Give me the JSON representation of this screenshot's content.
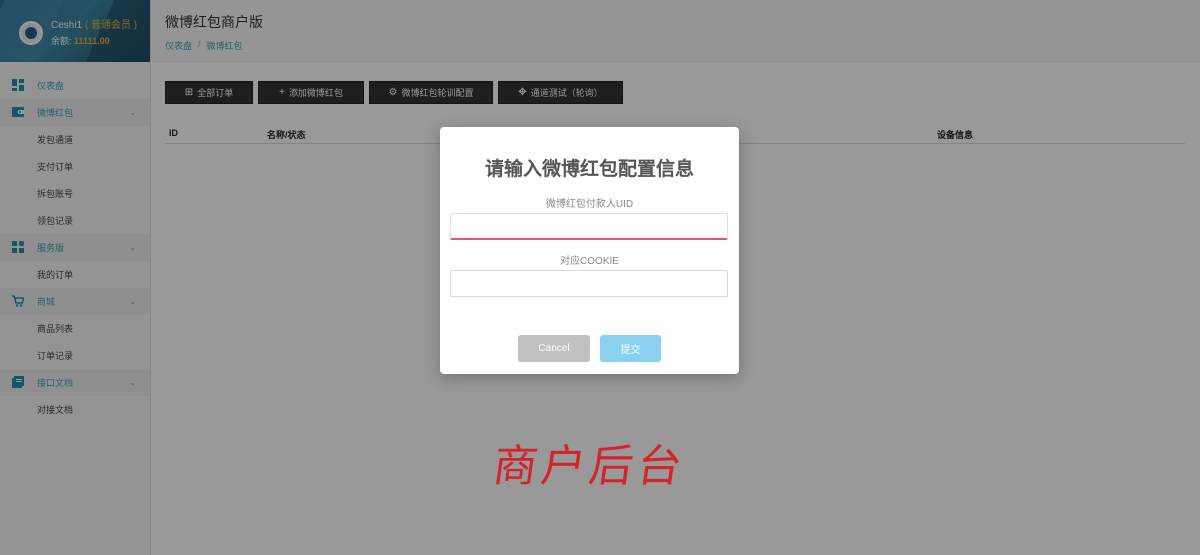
{
  "profile": {
    "name": "Ceshi1",
    "vip_badge": "( 普通会员 )",
    "balance_label": "余额:",
    "balance_value": "11111.00"
  },
  "sidebar": {
    "items": [
      {
        "label": "仪表盘",
        "icon": "dashboard-icon",
        "type": "parent",
        "expandable": false
      },
      {
        "label": "微博红包",
        "icon": "wallet-icon",
        "type": "parent",
        "expandable": true
      },
      {
        "label": "发包通道",
        "type": "child"
      },
      {
        "label": "支付订单",
        "type": "child"
      },
      {
        "label": "拆包账号",
        "type": "child"
      },
      {
        "label": "领包记录",
        "type": "child"
      },
      {
        "label": "服务版",
        "icon": "grid-icon",
        "type": "parent",
        "expandable": true
      },
      {
        "label": "我的订单",
        "type": "child"
      },
      {
        "label": "商城",
        "icon": "cart-icon",
        "type": "parent",
        "expandable": true
      },
      {
        "label": "商品列表",
        "type": "child"
      },
      {
        "label": "订单记录",
        "type": "child"
      },
      {
        "label": "接口文档",
        "icon": "docs-icon",
        "type": "parent",
        "expandable": true
      },
      {
        "label": "对接文档",
        "type": "child"
      }
    ]
  },
  "header": {
    "title": "微博红包商户版",
    "breadcrumb": [
      "仪表盘",
      "微博红包"
    ]
  },
  "toolbar": {
    "buttons": [
      {
        "label": "全部订单",
        "icon": "table-icon"
      },
      {
        "label": "添加微博红包",
        "icon": "plus-icon"
      },
      {
        "label": "微博红包轮训配置",
        "icon": "gear-icon"
      },
      {
        "label": "通道测试（轮询）",
        "icon": "gamepad-icon"
      }
    ]
  },
  "table": {
    "columns": [
      "ID",
      "名称/状态",
      "设备信息"
    ]
  },
  "modal": {
    "title": "请输入微博红包配置信息",
    "field1_label": "微博红包付款人UID",
    "field1_value": "",
    "field2_label": "对应COOKIE",
    "field2_value": "",
    "cancel_label": "Cancel",
    "submit_label": "提交"
  },
  "watermark": "商户后台",
  "colors": {
    "accent": "#3aa4b9",
    "vip": "#e8b627",
    "toolbar_button": "#333333",
    "submit": "#8bd0ef",
    "cancel": "#c1c1c1",
    "watermark": "#d4232b"
  }
}
